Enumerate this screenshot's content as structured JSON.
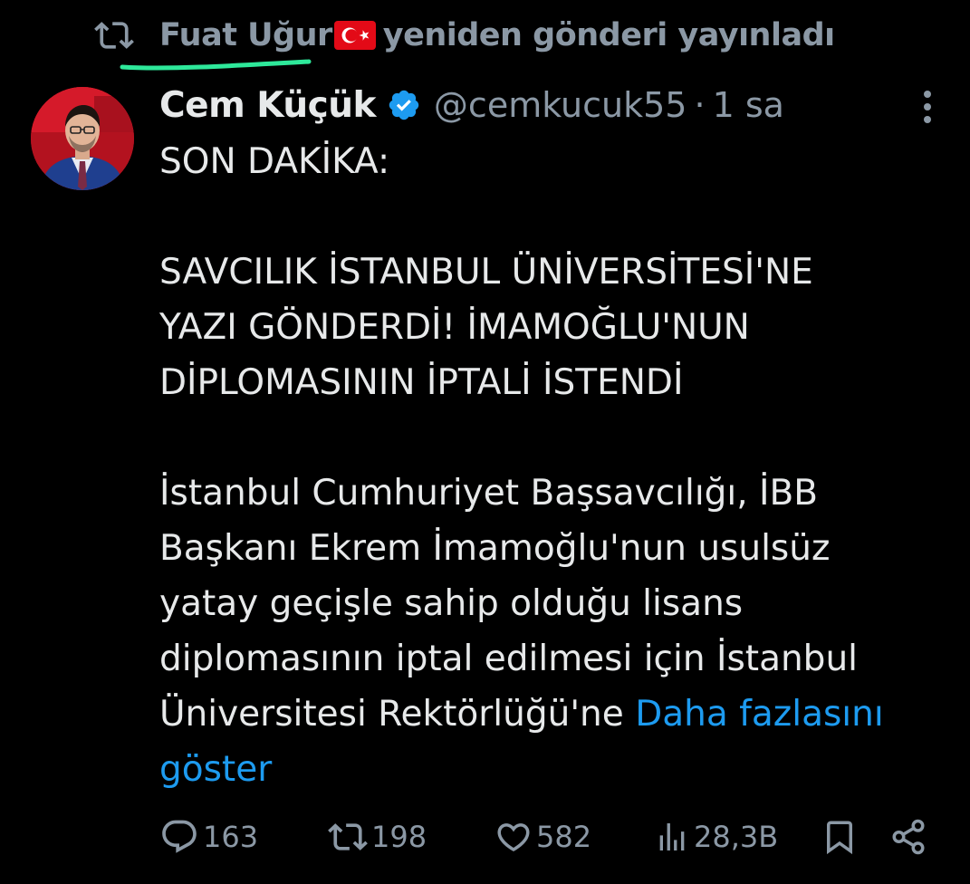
{
  "retweet": {
    "user": "Fuat Uğur",
    "text": "yeniden gönderi yayınladı"
  },
  "tweet": {
    "display_name": "Cem Küçük",
    "handle": "@cemkucuk55",
    "separator": "·",
    "time": "1 sa",
    "lines": [
      "SON DAKİKA:",
      "SAVCILIK İSTANBUL ÜNİVERSİTESİ'NE",
      "YAZI GÖNDERDİ! İMAMOĞLU'NUN",
      "DİPLOMASININ İPTALİ İSTENDİ",
      "İstanbul Cumhuriyet Başsavcılığı, İBB",
      "Başkanı Ekrem İmamoğlu'nun usulsüz",
      "yatay geçişle sahip olduğu lisans",
      "diplomasının iptal edilmesi için İstanbul",
      "Üniversitesi Rektörlüğü'ne"
    ],
    "show_more_part1": "Daha fazlasını",
    "show_more_part2": "göster"
  },
  "actions": {
    "replies": "163",
    "retweets": "198",
    "likes": "582",
    "views": "28,3B"
  },
  "icons": {
    "retweet": "retweet-icon",
    "flag": "turkey-flag-icon",
    "verified": "verified-badge-icon",
    "more": "more-options-icon",
    "reply": "reply-icon",
    "like": "heart-icon",
    "views": "views-icon",
    "bookmark": "bookmark-icon",
    "share": "share-icon"
  },
  "colors": {
    "background": "#000000",
    "text": "#e7e9ea",
    "muted": "#8b98a5",
    "link": "#1d9bf0",
    "underline_mark": "#2ee89a"
  }
}
